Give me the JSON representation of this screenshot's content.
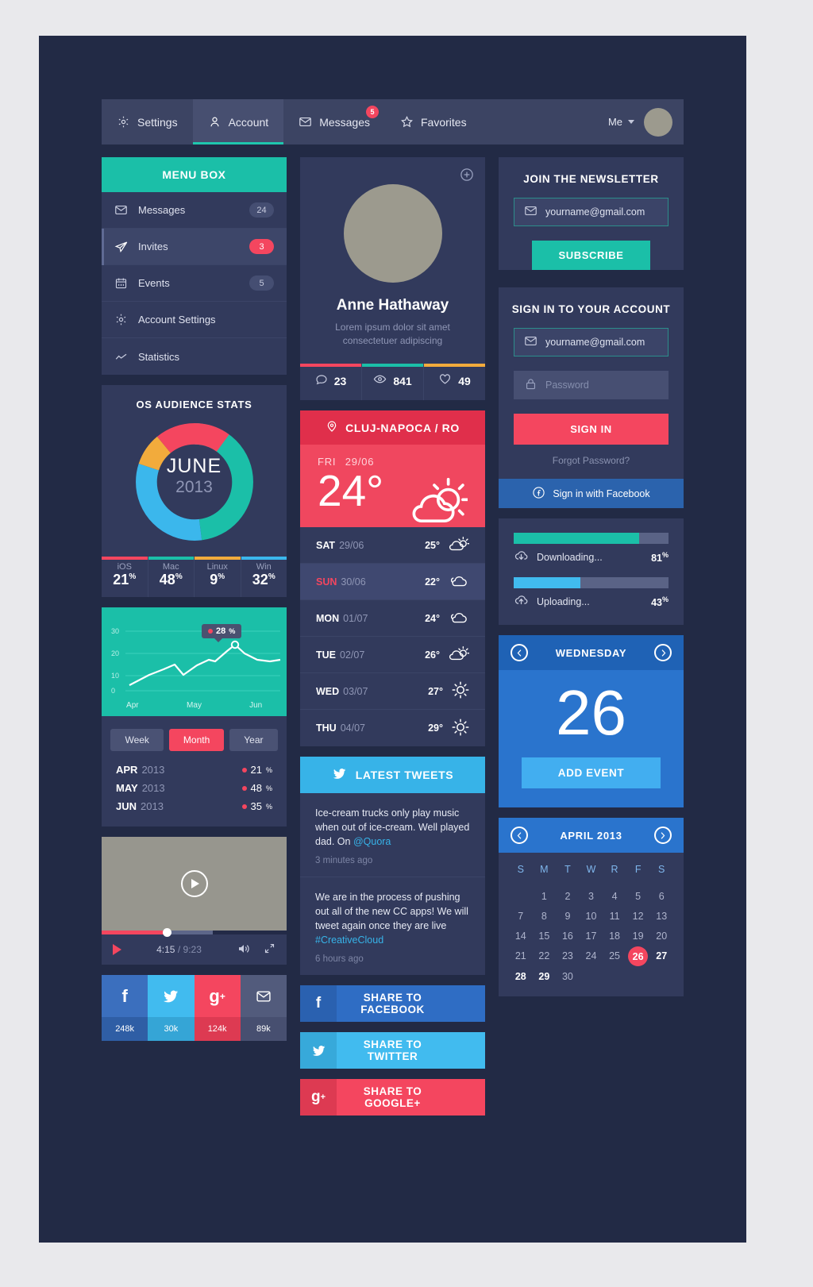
{
  "nav": {
    "items": [
      {
        "label": "Settings",
        "icon": "gear-icon",
        "badge": null,
        "active": false
      },
      {
        "label": "Account",
        "icon": "user-icon",
        "badge": null,
        "active": true
      },
      {
        "label": "Messages",
        "icon": "envelope-icon",
        "badge": "5",
        "active": false
      },
      {
        "label": "Favorites",
        "icon": "star-icon",
        "badge": null,
        "active": false
      }
    ],
    "me_label": "Me"
  },
  "menubox": {
    "title": "MENU BOX",
    "items": [
      {
        "label": "Messages",
        "count": "24",
        "icon": "envelope-icon",
        "active": false,
        "red": false
      },
      {
        "label": "Invites",
        "count": "3",
        "icon": "paper-plane-icon",
        "active": true,
        "red": true
      },
      {
        "label": "Events",
        "count": "5",
        "icon": "calendar-icon",
        "active": false,
        "red": false
      },
      {
        "label": "Account Settings",
        "count": "",
        "icon": "gear-icon",
        "active": false,
        "red": false
      },
      {
        "label": "Statistics",
        "count": "",
        "icon": "chart-line-icon",
        "active": false,
        "red": false
      }
    ]
  },
  "os_stats": {
    "title": "OS AUDIENCE STATS",
    "center_month": "JUNE",
    "center_year": "2013",
    "legend": [
      {
        "name": "iOS",
        "value": "21",
        "suffix": "%",
        "color": "#f4465f"
      },
      {
        "name": "Mac",
        "value": "48",
        "suffix": "%",
        "color": "#1bbfa8"
      },
      {
        "name": "Linux",
        "value": "9",
        "suffix": "%",
        "color": "#f2ab3c"
      },
      {
        "name": "Win",
        "value": "32",
        "suffix": "%",
        "color": "#3bb7ec"
      }
    ]
  },
  "line_chart": {
    "tooltip": "28",
    "tooltip_suffix": "%",
    "y_ticks": [
      "30",
      "20",
      "10",
      "0"
    ],
    "x_labels": [
      "Apr",
      "May",
      "Jun"
    ]
  },
  "segments": {
    "options": [
      "Week",
      "Month",
      "Year"
    ],
    "selected": "Month"
  },
  "monthly_stats": [
    {
      "month": "APR",
      "year": "2013",
      "delta": "21",
      "suffix": "%"
    },
    {
      "month": "MAY",
      "year": "2013",
      "delta": "48",
      "suffix": "%"
    },
    {
      "month": "JUN",
      "year": "2013",
      "delta": "35",
      "suffix": "%"
    }
  ],
  "video": {
    "current": "4:15",
    "separator": "/",
    "total": "9:23"
  },
  "social_tiles": [
    {
      "icon": "facebook-icon",
      "glyph": "f",
      "count": "248k",
      "color": "#3b6fbe",
      "footer": "#2f5ea5"
    },
    {
      "icon": "twitter-icon",
      "glyph": "t",
      "count": "30k",
      "color": "#41bbef",
      "footer": "#35a5d6"
    },
    {
      "icon": "googleplus-icon",
      "glyph": "g+",
      "count": "124k",
      "color": "#f4465f",
      "footer": "#dd3a52"
    },
    {
      "icon": "envelope-icon",
      "glyph": "m",
      "count": "89k",
      "color": "#525b7c",
      "footer": "#474f70"
    }
  ],
  "profile": {
    "name": "Anne Hathaway",
    "description": "Lorem ipsum dolor sit amet consectetuer adipiscing",
    "stats": [
      {
        "icon": "comment-icon",
        "value": "23",
        "color": "#f4465f"
      },
      {
        "icon": "eye-icon",
        "value": "841",
        "color": "#1bbfa8"
      },
      {
        "icon": "heart-icon",
        "value": "49",
        "color": "#f2ab3c"
      }
    ]
  },
  "weather": {
    "location": "CLUJ-NAPOCA / RO",
    "today_day": "FRI",
    "today_date": "29/06",
    "today_temp": "24°",
    "today_icon": "sun-cloud-icon",
    "forecast": [
      {
        "day": "SAT",
        "date": "29/06",
        "temp": "25°",
        "icon": "sun-cloud-icon",
        "highlight": false
      },
      {
        "day": "SUN",
        "date": "30/06",
        "temp": "22°",
        "icon": "cloud-icon",
        "highlight": true
      },
      {
        "day": "MON",
        "date": "01/07",
        "temp": "24°",
        "icon": "cloud-icon",
        "highlight": false
      },
      {
        "day": "TUE",
        "date": "02/07",
        "temp": "26°",
        "icon": "sun-cloud-icon",
        "highlight": false
      },
      {
        "day": "WED",
        "date": "03/07",
        "temp": "27°",
        "icon": "sun-icon",
        "highlight": false
      },
      {
        "day": "THU",
        "date": "04/07",
        "temp": "29°",
        "icon": "sun-icon",
        "highlight": false
      }
    ]
  },
  "tweets": {
    "title": "LATEST TWEETS",
    "items": [
      {
        "text": "Ice-cream trucks only play music when out of ice-cream. Well played dad. On ",
        "link": "@Quora",
        "ago": "3 minutes ago"
      },
      {
        "text": "We are in the process of pushing out all of the new CC apps! We will tweet again once they are live ",
        "link": "#CreativeCloud",
        "ago": "6 hours ago"
      }
    ]
  },
  "share_buttons": [
    {
      "label": "SHARE TO FACEBOOK",
      "glyph": "f",
      "icon": "facebook-icon",
      "color": "#2f6dc4",
      "icon_bg": "#2a61b0"
    },
    {
      "label": "SHARE TO TWITTER",
      "glyph": "t",
      "icon": "twitter-icon",
      "color": "#41bbef",
      "icon_bg": "#37a9da"
    },
    {
      "label": "SHARE TO GOOGLE+",
      "glyph": "g+",
      "icon": "googleplus-icon",
      "color": "#f4465f",
      "icon_bg": "#dd3a52"
    }
  ],
  "newsletter": {
    "title": "JOIN THE NEWSLETTER",
    "email_value": "yourname@gmail.com",
    "button": "SUBSCRIBE"
  },
  "signin": {
    "title": "SIGN IN TO YOUR ACCOUNT",
    "email_value": "yourname@gmail.com",
    "password_placeholder": "Password",
    "button": "SIGN IN",
    "forgot": "Forgot Password?",
    "facebook": "Sign in with Facebook"
  },
  "transfers": [
    {
      "label": "Downloading...",
      "percent": "81",
      "suffix": "%",
      "fill": 81,
      "color": "#1bbfa8",
      "icon": "cloud-download-icon"
    },
    {
      "label": "Uploading...",
      "percent": "43",
      "suffix": "%",
      "fill": 35,
      "color": "#41bbef",
      "icon": "cloud-upload-icon"
    }
  ],
  "day_widget": {
    "title": "WEDNESDAY",
    "number": "26",
    "button": "ADD EVENT"
  },
  "calendar": {
    "title": "APRIL 2013",
    "dow": [
      "S",
      "M",
      "T",
      "W",
      "R",
      "F",
      "S"
    ],
    "lead_blanks": 1,
    "days": [
      1,
      2,
      3,
      4,
      5,
      6,
      7,
      8,
      9,
      10,
      11,
      12,
      13,
      14,
      15,
      16,
      17,
      18,
      19,
      20,
      21,
      22,
      23,
      24,
      25,
      26,
      27,
      28,
      29,
      30
    ],
    "today": 26,
    "bold_days": [
      27,
      28,
      29
    ]
  },
  "colors": {
    "bg": "#222a45",
    "card": "#323a5c",
    "teal": "#1bbfa8",
    "red": "#f4465f",
    "blue": "#2a74cd",
    "lightblue": "#41bbef",
    "orange": "#f2ab3c"
  }
}
